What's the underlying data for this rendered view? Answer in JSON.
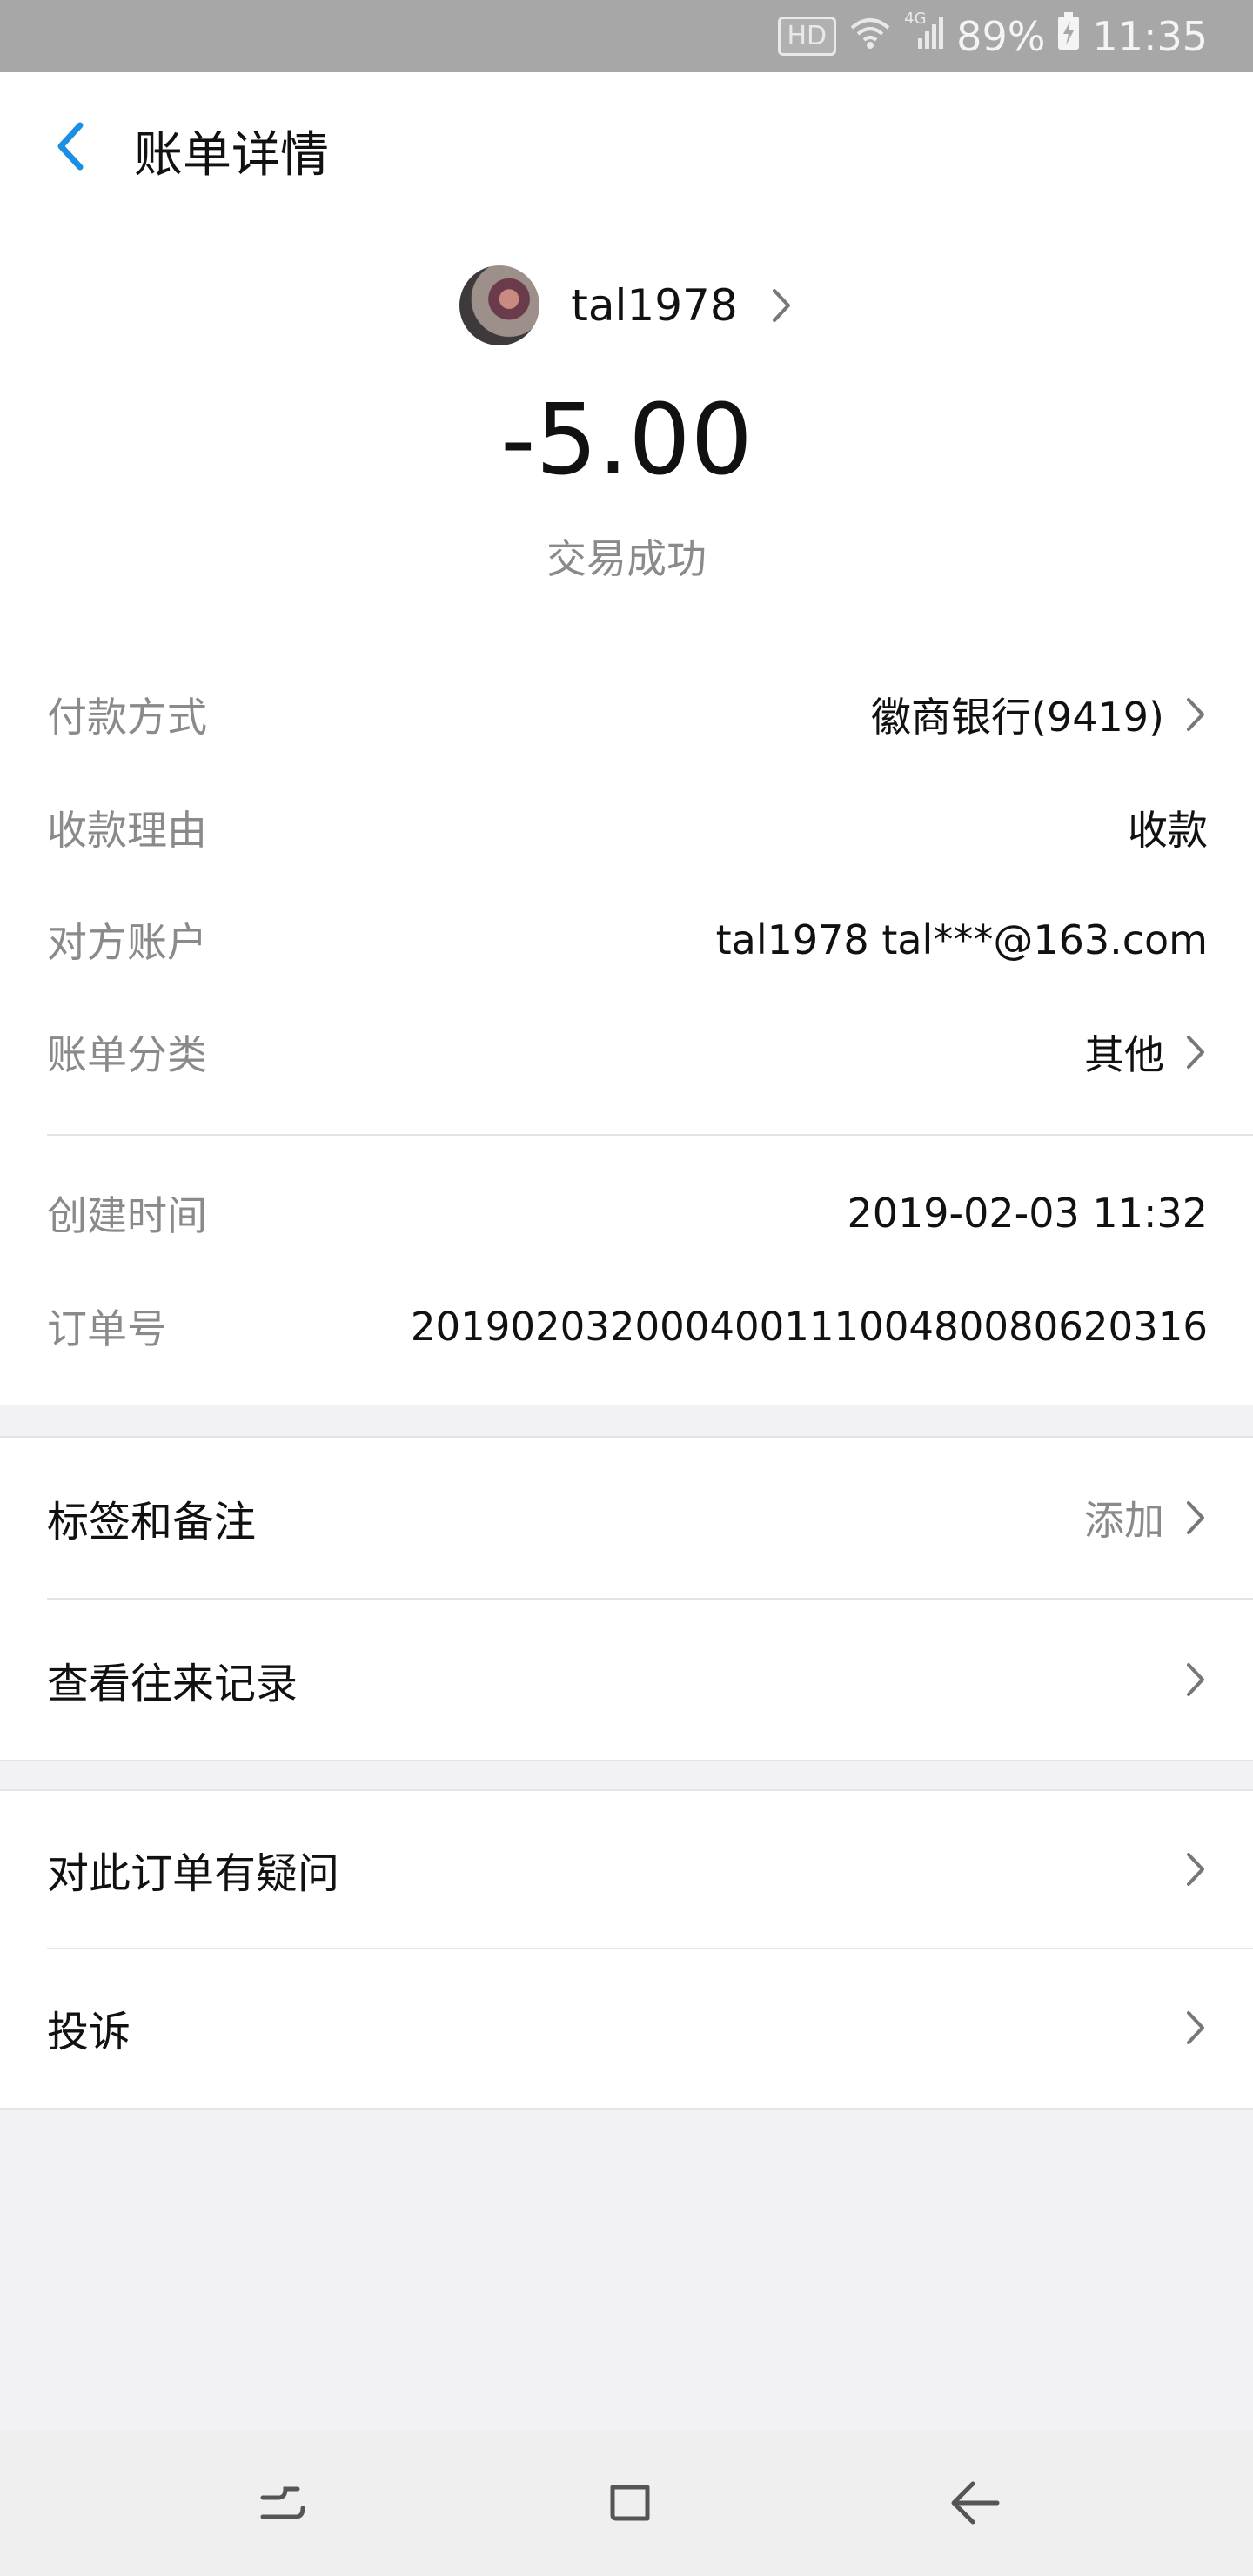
{
  "status_bar": {
    "hd": "HD",
    "network": "4G",
    "battery": "89%",
    "time": "11:35"
  },
  "nav": {
    "title": "账单详情",
    "back_icon": "chevron-left-icon"
  },
  "payee": {
    "name": "tal1978"
  },
  "amount": "-5.00",
  "trade_status": "交易成功",
  "details": [
    {
      "label": "付款方式",
      "value": "徽商银行(9419)",
      "has_arrow": true
    },
    {
      "label": "收款理由",
      "value": "收款",
      "has_arrow": false
    },
    {
      "label": "对方账户",
      "value": "tal1978 tal***@163.com",
      "has_arrow": false
    },
    {
      "label": "账单分类",
      "value": "其他",
      "has_arrow": true
    }
  ],
  "meta": [
    {
      "label": "创建时间",
      "value": "2019-02-03 11:32"
    },
    {
      "label": "订单号",
      "value": "20190203200040011100480080620316"
    }
  ],
  "section1": [
    {
      "label": "标签和备注",
      "hint": "添加"
    },
    {
      "label": "查看往来记录",
      "hint": ""
    }
  ],
  "section2": [
    {
      "label": "对此订单有疑问"
    },
    {
      "label": "投诉"
    }
  ],
  "colors": {
    "accent": "#1a8fe3",
    "status_bar": "#a7a7a7",
    "background": "#f2f2f6"
  }
}
